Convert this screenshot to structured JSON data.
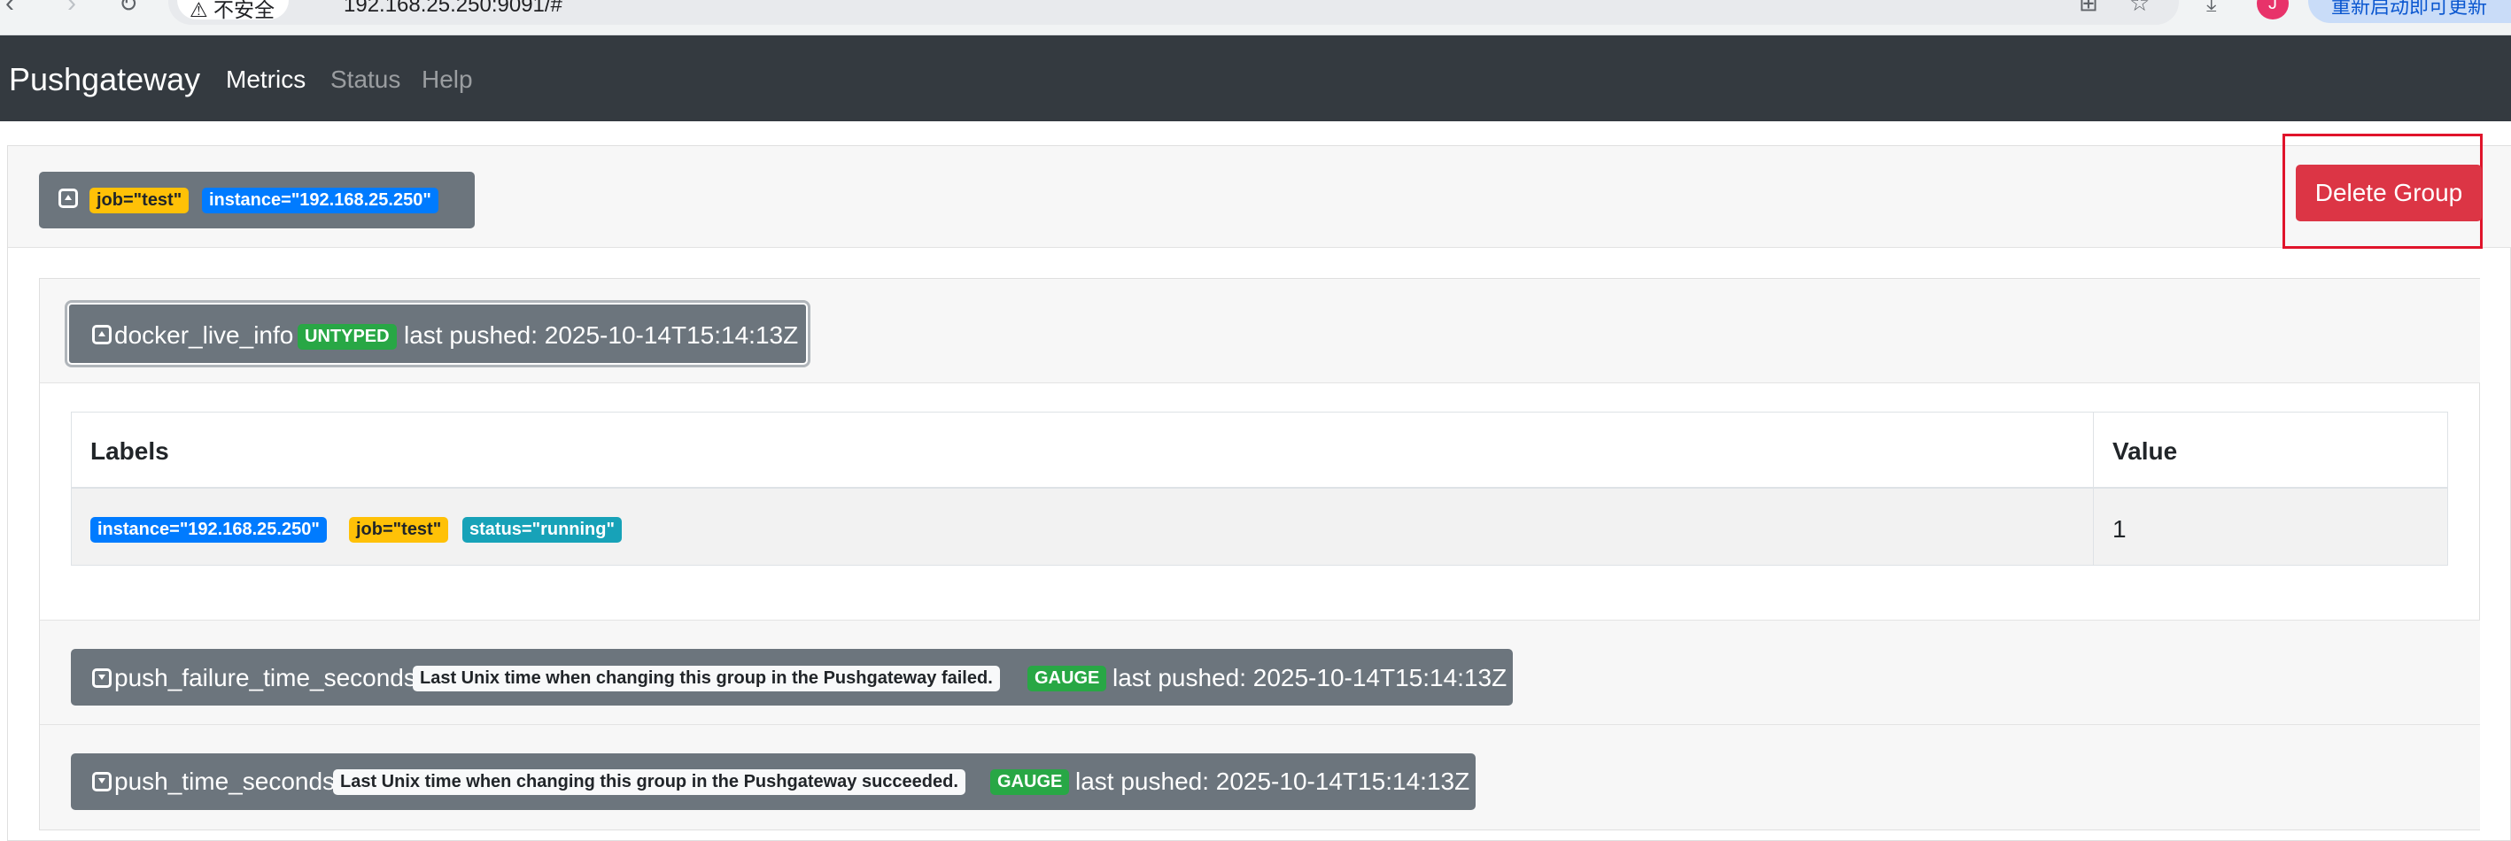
{
  "browser": {
    "security_label": "不安全",
    "url": "192.168.25.250:9091/#",
    "profile_initial": "J",
    "update_label": "重新启动即可更新"
  },
  "navbar": {
    "brand": "Pushgateway",
    "links": [
      {
        "label": "Metrics",
        "active": true
      },
      {
        "label": "Status",
        "active": false
      },
      {
        "label": "Help",
        "active": false
      }
    ]
  },
  "group": {
    "labels": [
      "job=\"test\"",
      "instance=\"192.168.25.250\""
    ],
    "delete_label": "Delete Group"
  },
  "metrics": [
    {
      "name": "docker_live_info",
      "type": "UNTYPED",
      "last_pushed": "last pushed: 2025-10-14T15:14:13Z",
      "expanded": true,
      "table": {
        "headers": [
          "Labels",
          "Value"
        ],
        "rows": [
          {
            "labels": [
              "instance=\"192.168.25.250\"",
              "job=\"test\"",
              "status=\"running\""
            ],
            "value": "1"
          }
        ]
      }
    },
    {
      "name": "push_failure_time_seconds",
      "help": "Last Unix time when changing this group in the Pushgateway failed.",
      "type": "GAUGE",
      "last_pushed": "last pushed: 2025-10-14T15:14:13Z",
      "expanded": false
    },
    {
      "name": "push_time_seconds",
      "help": "Last Unix time when changing this group in the Pushgateway succeeded.",
      "type": "GAUGE",
      "last_pushed": "last pushed: 2025-10-14T15:14:13Z",
      "expanded": false
    }
  ],
  "colors": {
    "navbar": "#343a40",
    "secondary": "#6c757d",
    "danger": "#dc3545",
    "warning": "#ffc107",
    "primary": "#007bff",
    "info": "#17a2b8",
    "success": "#28a745"
  }
}
